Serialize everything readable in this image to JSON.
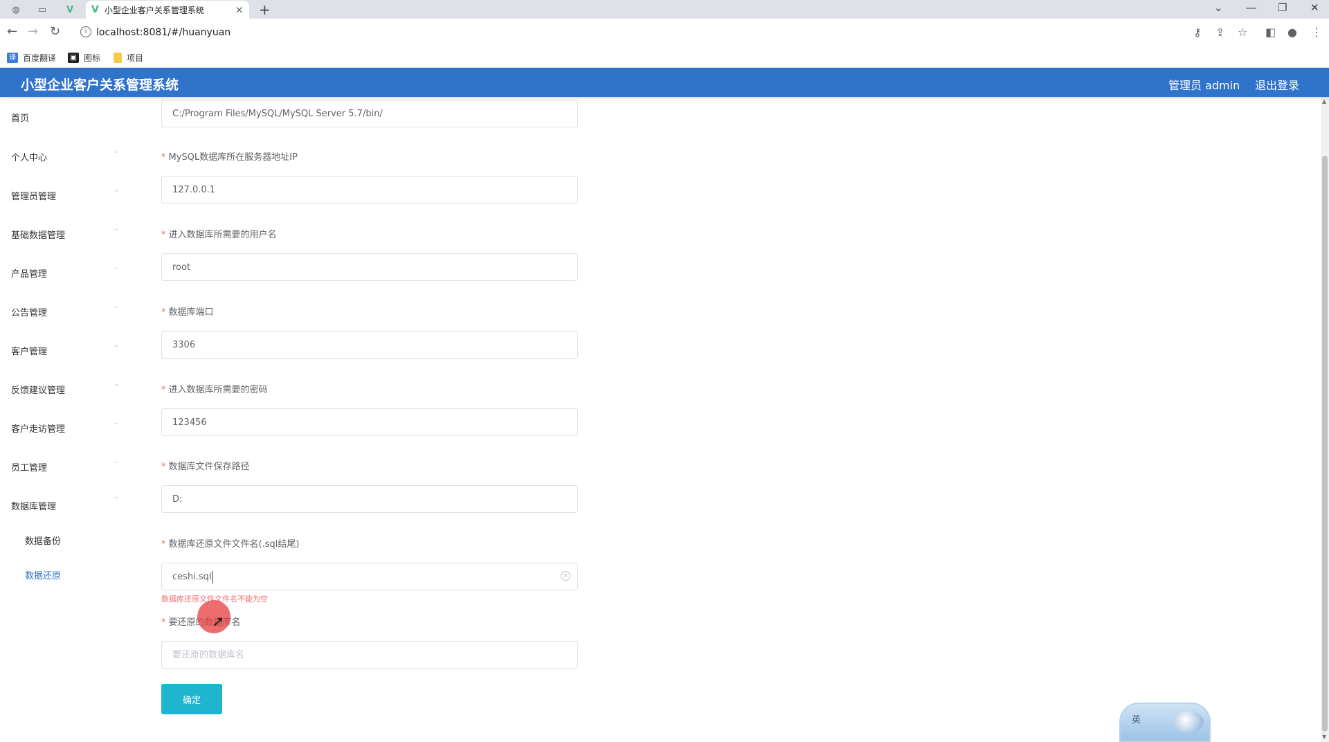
{
  "browser": {
    "tab_title": "小型企业客户关系管理系统",
    "url": "localhost:8081/#/huanyuan",
    "bookmarks": [
      {
        "label": "百度翻译",
        "icon": "translate-icon",
        "color": "#3a7bdc"
      },
      {
        "label": "图标",
        "icon": "image-icon",
        "color": "#222222"
      },
      {
        "label": "项目",
        "icon": "folder-icon",
        "color": "#f7c948"
      }
    ]
  },
  "header": {
    "title": "小型企业客户关系管理系统",
    "role_user": "管理员 admin",
    "logout": "退出登录",
    "bg_color": "#2f73cb"
  },
  "sidebar": {
    "items": [
      {
        "label": "首页"
      },
      {
        "label": "个人中心"
      },
      {
        "label": "管理员管理"
      },
      {
        "label": "基础数据管理"
      },
      {
        "label": "产品管理"
      },
      {
        "label": "公告管理"
      },
      {
        "label": "客户管理"
      },
      {
        "label": "反馈建议管理"
      },
      {
        "label": "客户走访管理"
      },
      {
        "label": "员工管理"
      },
      {
        "label": "数据库管理"
      }
    ],
    "sub_items": [
      {
        "label": "数据备份"
      },
      {
        "label": "数据还原",
        "active": true
      }
    ]
  },
  "form": {
    "mysql_path_value": "C:/Program Files/MySQL/MySQL Server 5.7/bin/",
    "host": {
      "label": "MySQL数据库所在服务器地址IP",
      "value": "127.0.0.1"
    },
    "username": {
      "label": "进入数据库所需要的用户名",
      "value": "root"
    },
    "port": {
      "label": "数据库端口",
      "value": "3306"
    },
    "password": {
      "label": "进入数据库所需要的密码",
      "value": "123456"
    },
    "save_path": {
      "label": "数据库文件保存路径",
      "value": "D:"
    },
    "restore_file": {
      "label": "数据库还原文件文件名(.sql结尾)",
      "value": "ceshi.sql",
      "error": "数据库还原文件文件名不能为空"
    },
    "restore_db": {
      "label": "要还原的数据库名",
      "value": "",
      "placeholder": "要还原的数据库名"
    },
    "submit_label": "确定",
    "required_mark": "*"
  },
  "ime": {
    "label": "英"
  }
}
